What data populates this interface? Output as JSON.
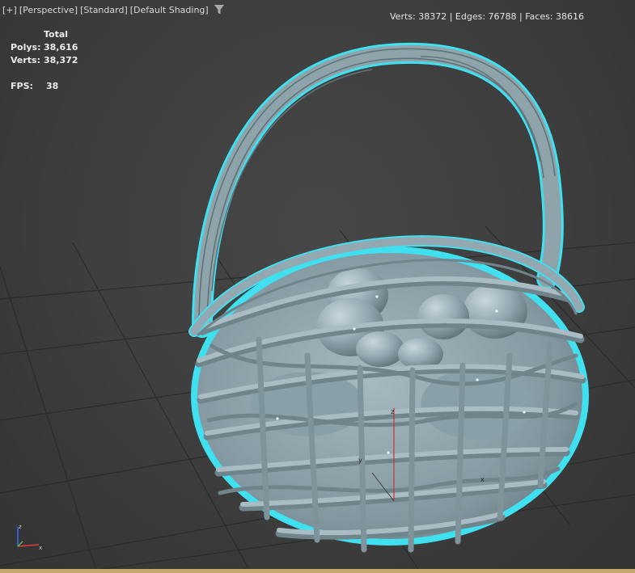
{
  "viewport_label": {
    "plus": "[+]",
    "view": "[Perspective]",
    "style": "[Standard]",
    "shading": "[Default Shading]",
    "filter_icon": "funnel-filter-icon"
  },
  "mesh_stats": "Verts: 38372 | Edges: 76788 | Faces: 38616",
  "stats": {
    "header": "Total",
    "polys_label": "Polys:",
    "polys_value": "38,616",
    "verts_label": "Verts:",
    "verts_value": "38,372",
    "fps_label": "FPS:",
    "fps_value": "38"
  },
  "gizmo": {
    "z_label": "z",
    "y_label": "y",
    "x_label": "x"
  },
  "axis_tripod": {
    "z": "z",
    "x": "x"
  },
  "colors": {
    "viewport_bg": "#3d3d3d",
    "grid_line": "#2a2a2a",
    "model_fill": "#8fa3ab",
    "selection_outline": "#3fe0ef",
    "bottom_bar": "#c5a86a",
    "axis_z": "#3b6bff",
    "axis_x": "#e23b3b",
    "axis_y": "#48c148"
  },
  "model": {
    "name": "wicker-basket-with-eggs",
    "selected": true
  }
}
